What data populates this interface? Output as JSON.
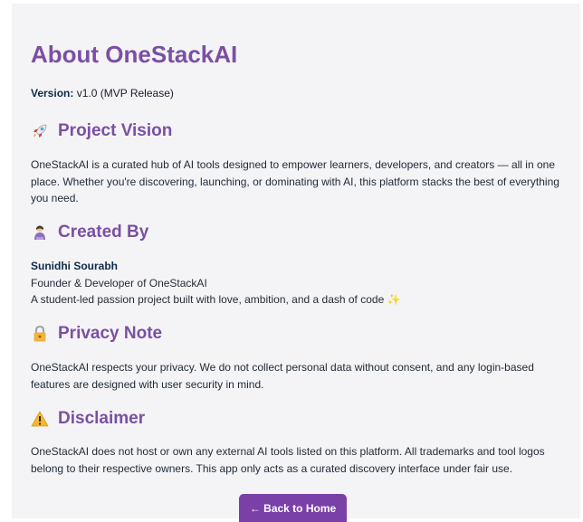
{
  "title": "About OneStackAI",
  "version": {
    "label": "Version:",
    "value": "v1.0 (MVP Release)"
  },
  "sections": {
    "vision": {
      "heading": "Project Vision",
      "icon": "rocket-icon",
      "text": "OneStackAI is a curated hub of AI tools designed to empower learners, developers, and creators — all in one place. Whether you're discovering, launching, or dominating with AI, this platform stacks the best of everything you need."
    },
    "created_by": {
      "heading": "Created By",
      "icon": "person-icon",
      "name": "Sunidhi Sourabh",
      "role": "Founder & Developer of OneStackAI",
      "tagline": "A student-led passion project built with love, ambition, and a dash of code",
      "tagline_emoji": "✨"
    },
    "privacy": {
      "heading": "Privacy Note",
      "icon": "lock-icon",
      "text": "OneStackAI respects your privacy. We do not collect personal data without consent, and any login-based features are designed with user security in mind."
    },
    "disclaimer": {
      "heading": "Disclaimer",
      "icon": "warning-icon",
      "text": "OneStackAI does not host or own any external AI tools listed on this platform. All trademarks and tool logos belong to their respective owners. This app only acts as a curated discovery interface under fair use."
    }
  },
  "back_button": {
    "label": "← Back to Home"
  },
  "colors": {
    "heading": "#7b4fa3",
    "button": "#7b3fa8",
    "text": "#1f2937",
    "panel": "#f4f4f6"
  }
}
